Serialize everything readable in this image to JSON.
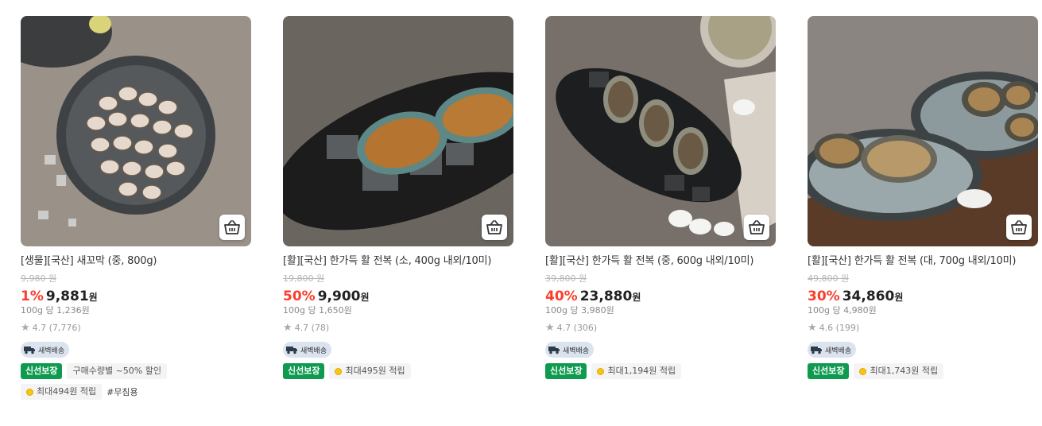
{
  "products": [
    {
      "title": "[생물][국산] 새꼬막 (중, 800g)",
      "original_price": "9,980 원",
      "discount": "1%",
      "price": "9,881",
      "won": "원",
      "unit_price": "100g 당 1,236원",
      "rating": "4.7 (7,776)",
      "delivery": "새벽배송",
      "badges": [
        "신선보장",
        "구매수량별 ~50% 할인"
      ],
      "points": "최대494원 적립",
      "hashtag": "#무침용"
    },
    {
      "title": "[활][국산] 한가득 활 전복 (소, 400g 내외/10미)",
      "original_price": "19,800 원",
      "discount": "50%",
      "price": "9,900",
      "won": "원",
      "unit_price": "100g 당 1,650원",
      "rating": "4.7 (78)",
      "delivery": "새벽배송",
      "badges": [
        "신선보장"
      ],
      "points": "최대495원 적립"
    },
    {
      "title": "[활][국산] 한가득 활 전복 (중, 600g 내외/10미)",
      "original_price": "39,800 원",
      "discount": "40%",
      "price": "23,880",
      "won": "원",
      "unit_price": "100g 당 3,980원",
      "rating": "4.7 (306)",
      "delivery": "새벽배송",
      "badges": [
        "신선보장"
      ],
      "points": "최대1,194원 적립"
    },
    {
      "title": "[활][국산] 한가득 활 전복 (대, 700g 내외/10미)",
      "original_price": "49,800 원",
      "discount": "30%",
      "price": "34,860",
      "won": "원",
      "unit_price": "100g 당 4,980원",
      "rating": "4.6 (199)",
      "delivery": "새벽배송",
      "badges": [
        "신선보장"
      ],
      "points": "최대1,743원 적립"
    }
  ],
  "icons": {
    "cart": "cart-icon",
    "star": "star-icon",
    "delivery": "truck-icon",
    "points": "coin-icon"
  },
  "colors": {
    "discount": "#fa3e2c",
    "fresh_badge": "#0f9b4f",
    "delivery_bg": "#dbe3ee"
  }
}
